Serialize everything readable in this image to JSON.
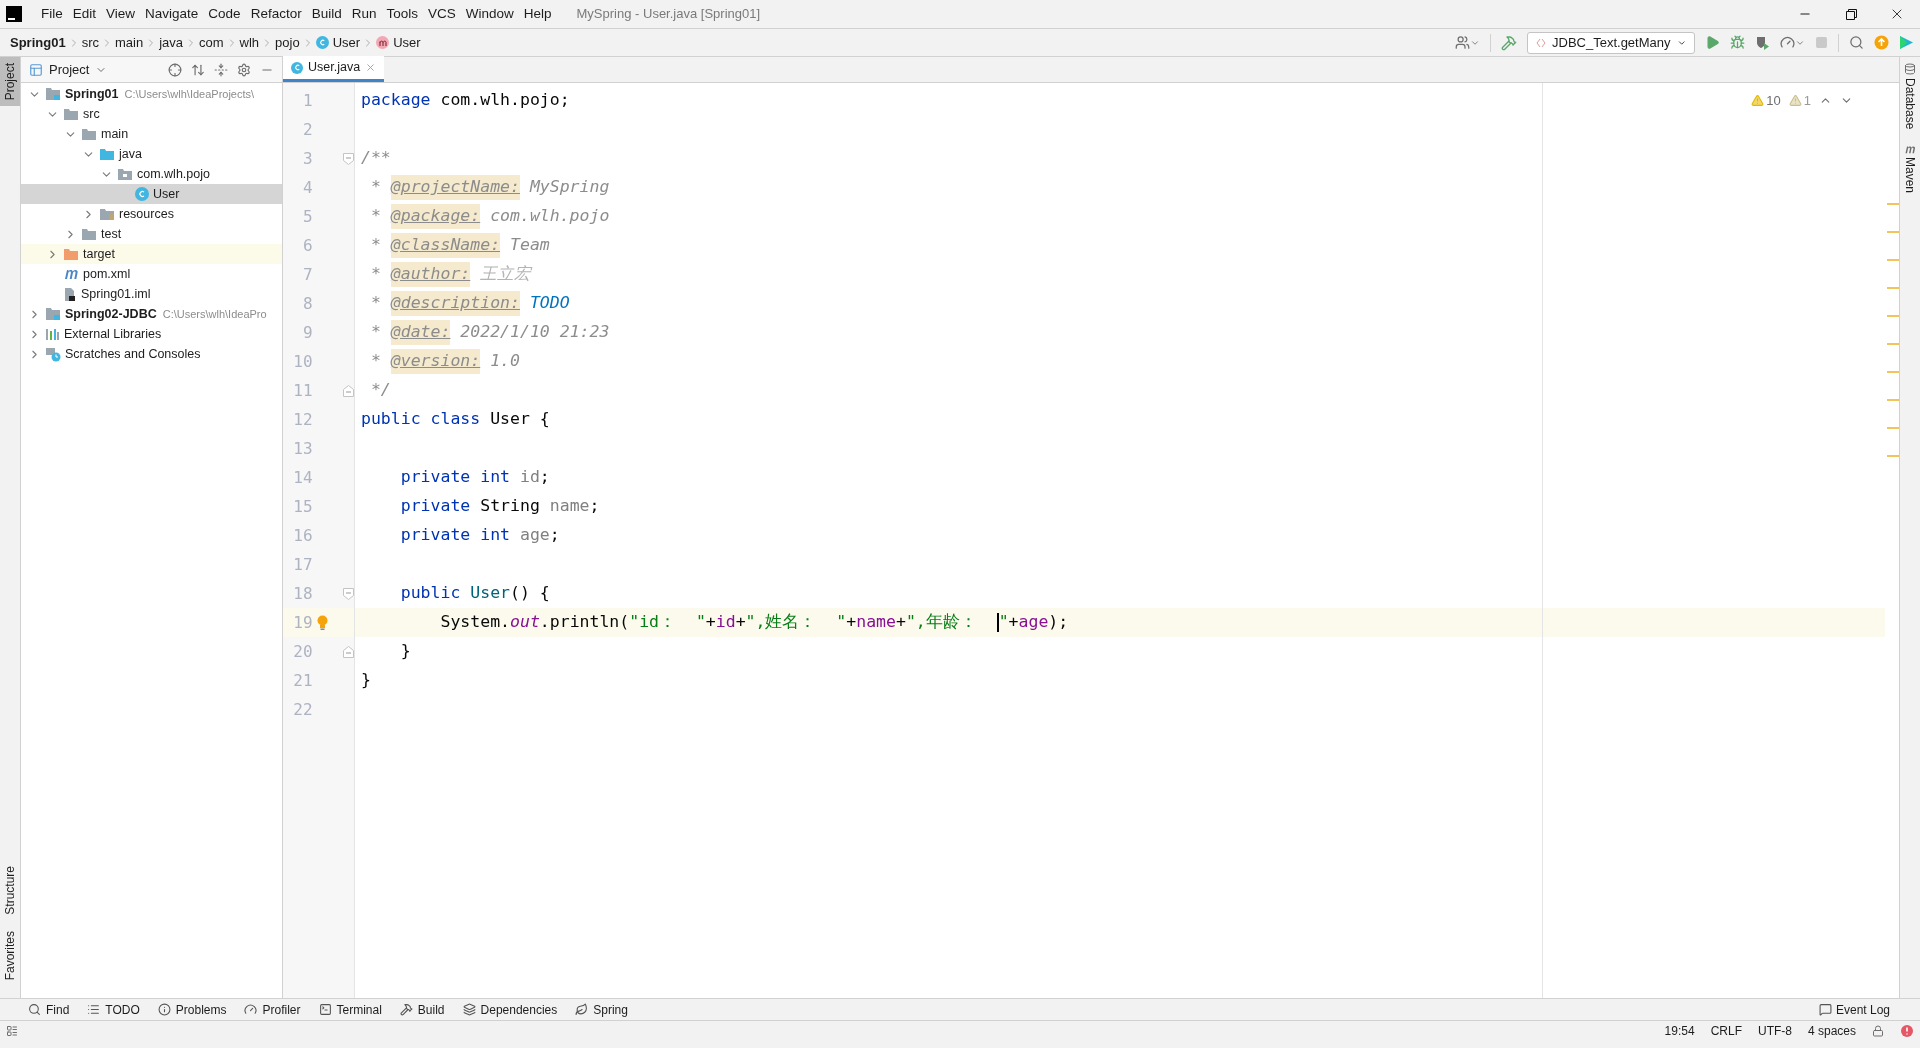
{
  "window": {
    "title": "MySpring - User.java [Spring01]"
  },
  "menu": [
    "File",
    "Edit",
    "View",
    "Navigate",
    "Code",
    "Refactor",
    "Build",
    "Run",
    "Tools",
    "VCS",
    "Window",
    "Help"
  ],
  "breadcrumbs": [
    {
      "label": "Spring01",
      "kind": "project"
    },
    {
      "label": "src",
      "kind": "folder"
    },
    {
      "label": "main",
      "kind": "folder"
    },
    {
      "label": "java",
      "kind": "folder"
    },
    {
      "label": "com",
      "kind": "folder"
    },
    {
      "label": "wlh",
      "kind": "folder"
    },
    {
      "label": "pojo",
      "kind": "folder"
    },
    {
      "label": "User",
      "kind": "class"
    },
    {
      "label": "User",
      "kind": "method"
    }
  ],
  "run_config": "JDBC_Text.getMany",
  "left_stripe_top": [
    {
      "label": "Project",
      "selected": true
    }
  ],
  "left_stripe_bottom": [
    {
      "label": "Structure",
      "selected": false
    },
    {
      "label": "Favorites",
      "selected": false
    }
  ],
  "right_stripe": [
    {
      "label": "Database",
      "kind": "database"
    },
    {
      "label": "Maven",
      "kind": "maven"
    }
  ],
  "project_panel": {
    "title": "Project",
    "tree": [
      {
        "label": "Spring01",
        "kind": "module",
        "hint": "C:\\Users\\wlh\\IdeaProjects\\",
        "expanded": true,
        "selected": false,
        "children": [
          {
            "label": "src",
            "kind": "folder",
            "expanded": true,
            "selected": false,
            "children": [
              {
                "label": "main",
                "kind": "folder",
                "expanded": true,
                "selected": false,
                "children": [
                  {
                    "label": "java",
                    "kind": "source-folder",
                    "expanded": true,
                    "selected": false,
                    "children": [
                      {
                        "label": "com.wlh.pojo",
                        "kind": "package",
                        "expanded": true,
                        "selected": false,
                        "children": [
                          {
                            "label": "User",
                            "kind": "class",
                            "selected": true
                          }
                        ]
                      }
                    ]
                  },
                  {
                    "label": "resources",
                    "kind": "resources",
                    "expanded": false,
                    "selected": false
                  }
                ]
              },
              {
                "label": "test",
                "kind": "folder",
                "expanded": false,
                "selected": false
              }
            ]
          },
          {
            "label": "target",
            "kind": "excluded-folder",
            "expanded": false,
            "selected": false
          },
          {
            "label": "pom.xml",
            "kind": "maven",
            "selected": false
          },
          {
            "label": "Spring01.iml",
            "kind": "iml",
            "selected": false
          }
        ]
      },
      {
        "label": "Spring02-JDBC",
        "kind": "module",
        "hint": "C:\\Users\\wlh\\IdeaPro",
        "expanded": false,
        "selected": false
      },
      {
        "label": "External Libraries",
        "kind": "libraries",
        "expanded": false,
        "selected": false
      },
      {
        "label": "Scratches and Consoles",
        "kind": "scratches",
        "expanded": false,
        "selected": false
      }
    ]
  },
  "editor": {
    "tabs": [
      {
        "label": "User.java",
        "selected": true
      }
    ],
    "inspections": {
      "warnings": "10",
      "weak_warnings": "1"
    },
    "lines": [
      {
        "number": "1",
        "tokens": [
          {
            "t": "package",
            "kind": "keyword"
          },
          {
            "t": " com.wlh.pojo;",
            "kind": "plain"
          }
        ]
      },
      {
        "number": "2"
      },
      {
        "number": "3",
        "fold_open": true,
        "tokens": [
          {
            "t": "/**",
            "kind": "comment"
          }
        ]
      },
      {
        "number": "4",
        "tokens": [
          {
            "t": " * ",
            "kind": "comment"
          },
          {
            "t": "@projectName:",
            "kind": "tag"
          },
          {
            "t": " MySpring",
            "kind": "comment"
          }
        ]
      },
      {
        "number": "5",
        "tokens": [
          {
            "t": " * ",
            "kind": "comment"
          },
          {
            "t": "@package:",
            "kind": "tag"
          },
          {
            "t": " com.wlh.pojo",
            "kind": "comment"
          }
        ]
      },
      {
        "number": "6",
        "tokens": [
          {
            "t": " * ",
            "kind": "comment"
          },
          {
            "t": "@className:",
            "kind": "tag"
          },
          {
            "t": " Team",
            "kind": "comment"
          }
        ]
      },
      {
        "number": "7",
        "tokens": [
          {
            "t": " * ",
            "kind": "comment"
          },
          {
            "t": "@author:",
            "kind": "tag"
          },
          {
            "t": " 王立宏",
            "kind": "comment-light"
          }
        ]
      },
      {
        "number": "8",
        "tokens": [
          {
            "t": " * ",
            "kind": "comment"
          },
          {
            "t": "@description:",
            "kind": "tag"
          },
          {
            "t": " TODO",
            "kind": "todo"
          }
        ]
      },
      {
        "number": "9",
        "tokens": [
          {
            "t": " * ",
            "kind": "comment"
          },
          {
            "t": "@date:",
            "kind": "tag"
          },
          {
            "t": " 2022/1/10 21:23",
            "kind": "comment"
          }
        ]
      },
      {
        "number": "10",
        "tokens": [
          {
            "t": " * ",
            "kind": "comment"
          },
          {
            "t": "@version:",
            "kind": "tag"
          },
          {
            "t": " 1.0",
            "kind": "comment"
          }
        ]
      },
      {
        "number": "11",
        "fold_close": true,
        "tokens": [
          {
            "t": " */",
            "kind": "comment"
          }
        ]
      },
      {
        "number": "12",
        "tokens": [
          {
            "t": "public class",
            "kind": "keyword"
          },
          {
            "t": " User {",
            "kind": "plain"
          }
        ]
      },
      {
        "number": "13"
      },
      {
        "number": "14",
        "tokens": [
          {
            "t": "    private int",
            "kind": "keyword"
          },
          {
            "t": " id",
            "kind": "unused"
          },
          {
            "t": ";",
            "kind": "plain"
          }
        ]
      },
      {
        "number": "15",
        "tokens": [
          {
            "t": "    private",
            "kind": "keyword"
          },
          {
            "t": " String ",
            "kind": "plain"
          },
          {
            "t": "name",
            "kind": "unused"
          },
          {
            "t": ";",
            "kind": "plain"
          }
        ]
      },
      {
        "number": "16",
        "tokens": [
          {
            "t": "    private int",
            "kind": "keyword"
          },
          {
            "t": " age",
            "kind": "unused"
          },
          {
            "t": ";",
            "kind": "plain"
          }
        ]
      },
      {
        "number": "17"
      },
      {
        "number": "18",
        "fold_open": true,
        "tokens": [
          {
            "t": "    public",
            "kind": "keyword"
          },
          {
            "t": " User",
            "kind": "method"
          },
          {
            "t": "() {",
            "kind": "plain"
          }
        ]
      },
      {
        "number": "19",
        "current": true,
        "bulb": true,
        "tokens": [
          {
            "t": "        System.",
            "kind": "plain"
          },
          {
            "t": "out",
            "kind": "static"
          },
          {
            "t": ".println(",
            "kind": "plain"
          },
          {
            "t": "\"id：  \"",
            "kind": "string"
          },
          {
            "t": "+",
            "kind": "plain"
          },
          {
            "t": "id",
            "kind": "field"
          },
          {
            "t": "+",
            "kind": "plain"
          },
          {
            "t": "\",姓名：  \"",
            "kind": "string"
          },
          {
            "t": "+",
            "kind": "plain"
          },
          {
            "t": "name",
            "kind": "field"
          },
          {
            "t": "+",
            "kind": "plain"
          },
          {
            "t": "\",年龄：  ",
            "kind": "string"
          },
          {
            "t": "\"",
            "kind": "string",
            "caret": true
          },
          {
            "t": "+",
            "kind": "plain"
          },
          {
            "t": "age",
            "kind": "field"
          },
          {
            "t": ");",
            "kind": "plain"
          }
        ]
      },
      {
        "number": "20",
        "fold_close": true,
        "tokens": [
          {
            "t": "    }",
            "kind": "plain"
          }
        ]
      },
      {
        "number": "21",
        "tokens": [
          {
            "t": "}",
            "kind": "plain"
          }
        ]
      },
      {
        "number": "22"
      }
    ]
  },
  "tool_windows": [
    {
      "label": "Find",
      "kind": "find"
    },
    {
      "label": "TODO",
      "kind": "todo"
    },
    {
      "label": "Problems",
      "kind": "problems"
    },
    {
      "label": "Profiler",
      "kind": "profiler"
    },
    {
      "label": "Terminal",
      "kind": "terminal"
    },
    {
      "label": "Build",
      "kind": "build"
    },
    {
      "label": "Dependencies",
      "kind": "dependencies"
    },
    {
      "label": "Spring",
      "kind": "spring"
    }
  ],
  "event_log": "Event Log",
  "status_bar": [
    "19:54",
    "CRLF",
    "UTF-8",
    "4 spaces"
  ]
}
